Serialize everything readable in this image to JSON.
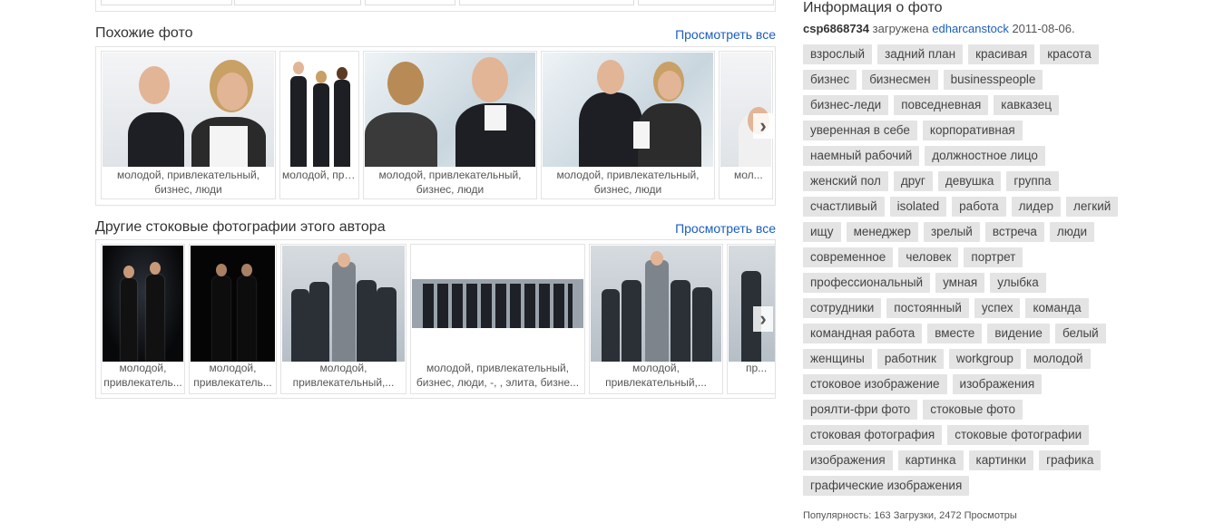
{
  "similar": {
    "title": "Похожие фото",
    "view_all": "Просмотреть все",
    "items": [
      {
        "caption": "молодой, привлекательный, бизнес, люди"
      },
      {
        "caption": "молодой, привлекател..."
      },
      {
        "caption": "молодой, привлекательный, бизнес, люди"
      },
      {
        "caption": "молодой, привлекательный, бизнес, люди"
      },
      {
        "caption": "мол..."
      }
    ]
  },
  "author": {
    "title": "Другие стоковые фотографии этого автора",
    "view_all": "Просмотреть все",
    "items": [
      {
        "line1": "молодой,",
        "line2": "привлекатель..."
      },
      {
        "line1": "молодой,",
        "line2": "привлекатель..."
      },
      {
        "line1": "молодой,",
        "line2": "привлекательный,..."
      },
      {
        "line1": "молодой, привлекательный,",
        "line2": "бизнес, люди, -, , элита, бизне..."
      },
      {
        "line1": "молодой,",
        "line2": "привлекательный,..."
      },
      {
        "line1": "",
        "line2": "пр..."
      }
    ]
  },
  "info": {
    "title": "Информация о фото",
    "image_id": "csp6868734",
    "uploaded_text": "загружена",
    "author": "edharcanstock",
    "date": "2011-08-06.",
    "tags": [
      "взрослый",
      "задний план",
      "красивая",
      "красота",
      "бизнес",
      "бизнесмен",
      "businesspeople",
      "бизнес-леди",
      "повседневная",
      "кавказец",
      "уверенная в себе",
      "корпоративная",
      "наемный рабочий",
      "должностное лицо",
      "женский пол",
      "друг",
      "девушка",
      "группа",
      "счастливый",
      "isolated",
      "работа",
      "лидер",
      "легкий",
      "ищу",
      "менеджер",
      "зрелый",
      "встреча",
      "люди",
      "современное",
      "человек",
      "портрет",
      "профессиональный",
      "умная",
      "улыбка",
      "сотрудники",
      "постоянный",
      "успех",
      "команда",
      "командная работа",
      "вместе",
      "видение",
      "белый",
      "женщины",
      "работник",
      "workgroup",
      "молодой",
      "стоковое изображение",
      "изображения",
      "роялти-фри фото",
      "стоковые фото",
      "стоковая фотография",
      "стоковые фотографии",
      "изображения",
      "картинка",
      "картинки",
      "графика",
      "графические изображения"
    ],
    "popularity": "Популярность: 163 Загрузки, 2472 Просмотры"
  },
  "icons": {
    "next": "chevron-right-icon"
  }
}
